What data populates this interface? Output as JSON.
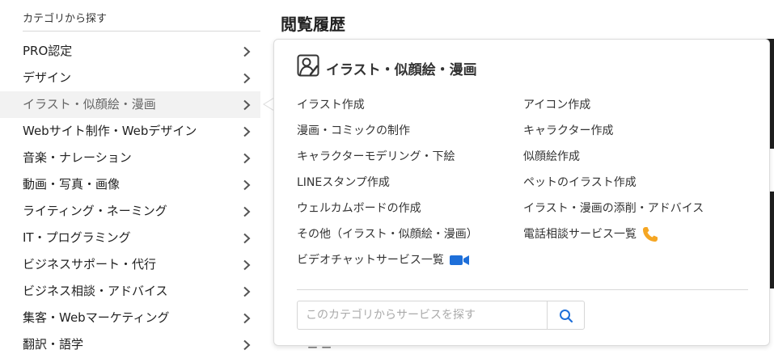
{
  "sidebar": {
    "title": "カテゴリから探す",
    "items": [
      {
        "label": "PRO認定",
        "active": false
      },
      {
        "label": "デザイン",
        "active": false
      },
      {
        "label": "イラスト・似顔絵・漫画",
        "active": true
      },
      {
        "label": "Webサイト制作・Webデザイン",
        "active": false
      },
      {
        "label": "音楽・ナレーション",
        "active": false
      },
      {
        "label": "動画・写真・画像",
        "active": false
      },
      {
        "label": "ライティング・ネーミング",
        "active": false
      },
      {
        "label": "IT・プログラミング",
        "active": false
      },
      {
        "label": "ビジネスサポート・代行",
        "active": false
      },
      {
        "label": "ビジネス相談・アドバイス",
        "active": false
      },
      {
        "label": "集客・Webマーケティング",
        "active": false
      },
      {
        "label": "翻訳・語学",
        "active": false
      }
    ]
  },
  "page": {
    "heading": "閲覧履歴"
  },
  "flyout": {
    "title": "イラスト・似顔絵・漫画",
    "title_icon": "person-drawing-icon",
    "left_links": [
      "イラスト作成",
      "漫画・コミックの制作",
      "キャラクターモデリング・下絵",
      "LINEスタンプ作成",
      "ウェルカムボードの作成",
      "その他（イラスト・似顔絵・漫画）",
      "ビデオチャットサービス一覧"
    ],
    "right_links": [
      "アイコン作成",
      "キャラクター作成",
      "似顔絵作成",
      "ペットのイラスト作成",
      "イラスト・漫画の添削・アドバイス",
      "電話相談サービス一覧"
    ],
    "video_icon": "video-camera-icon",
    "phone_icon": "phone-icon",
    "search_placeholder": "このカテゴリからサービスを探す",
    "search_icon": "search-icon"
  },
  "colors": {
    "accent_blue": "#1e6fd9",
    "phone_orange": "#f5a623",
    "active_bg": "#f2f2f2"
  }
}
